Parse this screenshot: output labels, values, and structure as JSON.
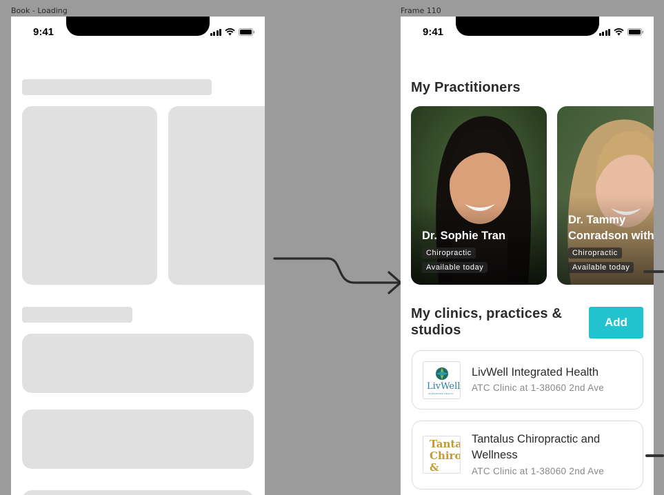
{
  "frames": {
    "left_label": "Book - Loading",
    "right_label": "Frame 110"
  },
  "status_bar": {
    "time": "9:41"
  },
  "practitioners": {
    "section_title": "My Practitioners",
    "items": [
      {
        "name": "Dr. Sophie Tran",
        "specialty": "Chiropractic",
        "availability": "Available today"
      },
      {
        "name_line1": "Dr. Tammy",
        "name_line2": "Conradson with",
        "specialty": "Chiropractic",
        "availability": "Available today"
      }
    ]
  },
  "clinics": {
    "section_title": "My clinics, practices & studios",
    "add_label": "Add",
    "items": [
      {
        "name": "LivWell Integrated Health",
        "address": "ATC Clinic at 1-38060 2nd Ave",
        "logo_text": "LivWell",
        "logo_sub": "INTEGRATED HEALTH"
      },
      {
        "name": "Tantalus Chiropractic and Wellness",
        "address": "ATC Clinic at 1-38060 2nd Ave",
        "logo_text": "Tanta Chiro & Wel"
      }
    ]
  },
  "colors": {
    "accent": "#21c3cf",
    "skeleton": "#e0e0e0",
    "canvas": "#9b9b9b"
  }
}
